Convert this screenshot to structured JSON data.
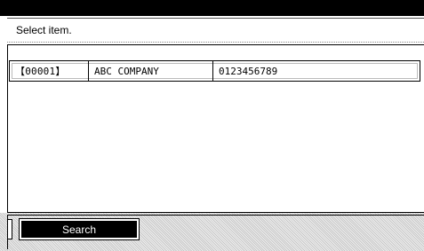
{
  "header": {
    "title": "Select item."
  },
  "list": {
    "rows": [
      {
        "code": "【00001】",
        "name": "ABC COMPANY",
        "phone": "0123456789"
      }
    ]
  },
  "footer": {
    "search_label": "Search"
  }
}
